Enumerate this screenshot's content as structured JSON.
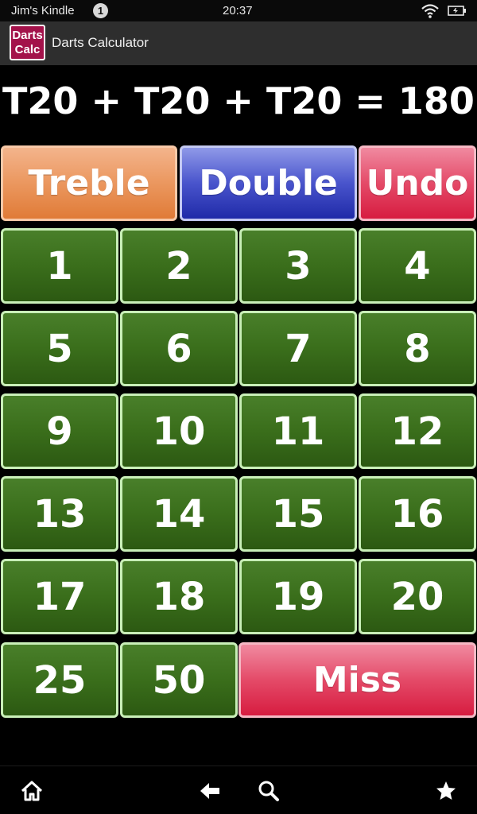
{
  "status_bar": {
    "device_name": "Jim's Kindle",
    "notification_count": "1",
    "time": "20:37"
  },
  "title_bar": {
    "icon_line1": "Darts",
    "icon_line2": "Calc",
    "title": "Darts Calculator"
  },
  "expression": "T20 + T20 + T20 = 180",
  "modifiers": {
    "treble": "Treble",
    "double": "Double",
    "undo": "Undo"
  },
  "numbers": [
    "1",
    "2",
    "3",
    "4",
    "5",
    "6",
    "7",
    "8",
    "9",
    "10",
    "11",
    "12",
    "13",
    "14",
    "15",
    "16",
    "17",
    "18",
    "19",
    "20"
  ],
  "specials": {
    "bull_outer": "25",
    "bull": "50",
    "miss": "Miss"
  },
  "nav_icons": [
    "home-icon",
    "back-icon",
    "search-icon",
    "favorites-icon"
  ],
  "colors": {
    "treble": "#e07b37",
    "double": "#2b36b5",
    "undo_miss": "#d71c40",
    "number_green": "#3a6e1b",
    "number_border": "#c9efb8",
    "app_icon": "#a3124a"
  }
}
